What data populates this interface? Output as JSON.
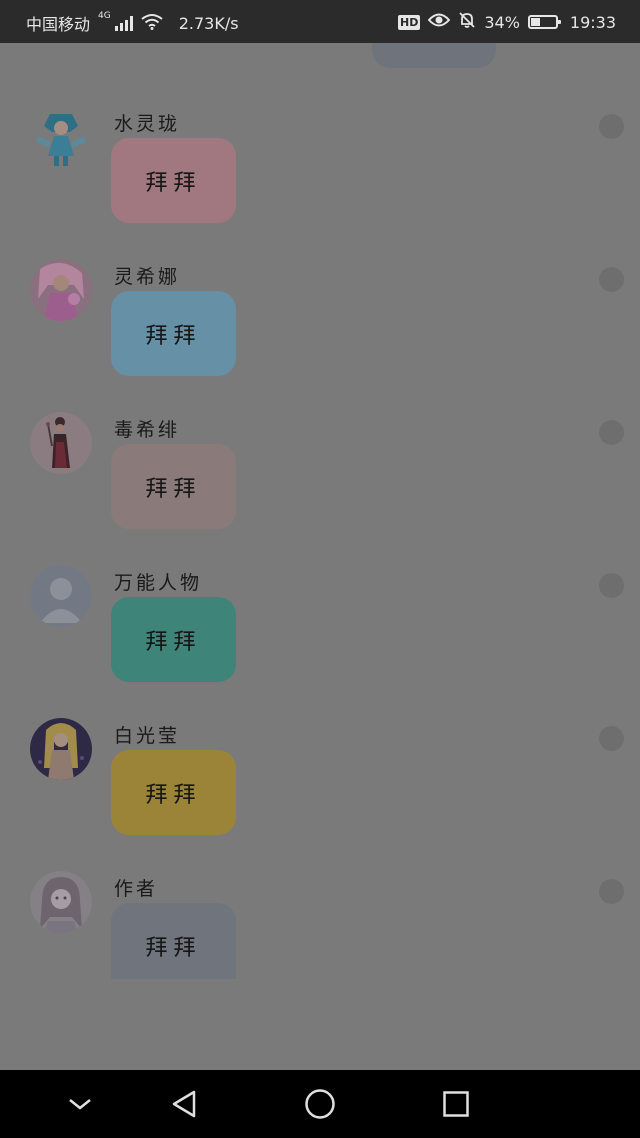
{
  "status_bar": {
    "carrier": "中国移动",
    "network_gen": "4G",
    "speed": "2.73K/s",
    "hd_badge": "HD",
    "battery_percent": "34%",
    "battery_level": 0.34,
    "time": "19:33",
    "icons": [
      "signal-icon",
      "wifi-icon",
      "eye-icon",
      "bell-off-icon",
      "battery-icon"
    ]
  },
  "messages": [
    {
      "name": "水灵珑",
      "text": "拜拜",
      "bubble_color": "#a17880",
      "avatar": "blue-hair-character"
    },
    {
      "name": "灵希娜",
      "text": "拜拜",
      "bubble_color": "#6590a6",
      "avatar": "pink-hair-character"
    },
    {
      "name": "毒希绯",
      "text": "拜拜",
      "bubble_color": "#8a7a7a",
      "avatar": "dark-dress-character"
    },
    {
      "name": "万能人物",
      "text": "拜拜",
      "bubble_color": "#3e8478",
      "avatar": "default-person"
    },
    {
      "name": "白光莹",
      "text": "拜拜",
      "bubble_color": "#9b8438",
      "avatar": "blonde-character"
    },
    {
      "name": "作者",
      "text": "拜拜",
      "bubble_color": "#70757d",
      "avatar": "sketch-girl"
    }
  ],
  "nav_bar": {
    "icons": [
      "chevron-down-icon",
      "back-triangle-icon",
      "home-circle-icon",
      "recents-square-icon"
    ]
  }
}
